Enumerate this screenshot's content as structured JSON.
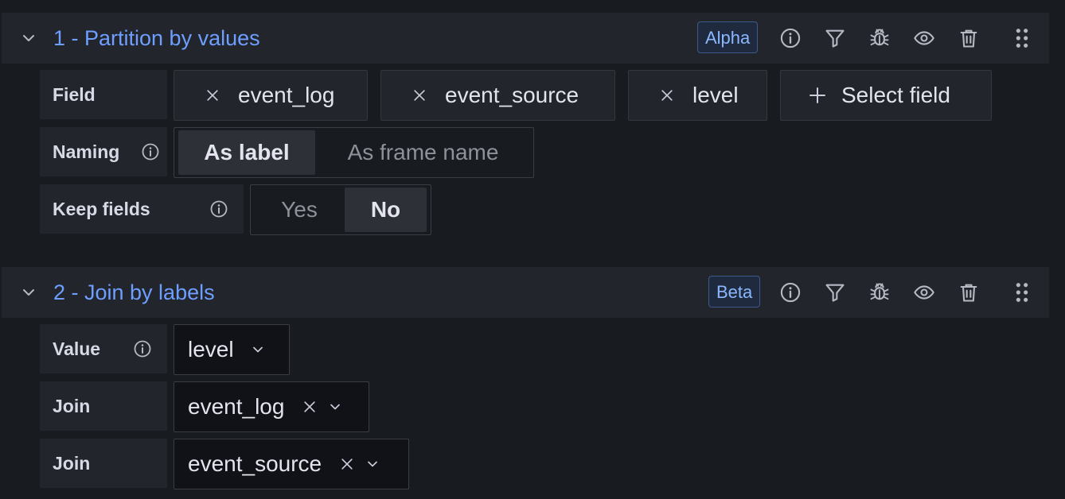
{
  "transform1": {
    "title": "1 - Partition by values",
    "badge": "Alpha",
    "field_label": "Field",
    "fields": [
      "event_log",
      "event_source",
      "level"
    ],
    "select_field_label": "Select field",
    "naming_label": "Naming",
    "naming_options": [
      "As label",
      "As frame name"
    ],
    "naming_selected": "As label",
    "keep_fields_label": "Keep fields",
    "keep_fields_options": [
      "Yes",
      "No"
    ],
    "keep_fields_selected": "No"
  },
  "transform2": {
    "title": "2 - Join by labels",
    "badge": "Beta",
    "value_label": "Value",
    "value_selected": "level",
    "join_label_1": "Join",
    "join_value_1": "event_log",
    "join_label_2": "Join",
    "join_value_2": "event_source"
  },
  "header_icons": [
    "info-icon",
    "filter-icon",
    "bug-icon",
    "eye-icon",
    "trash-icon",
    "drag-handle-icon"
  ],
  "colors": {
    "background": "#181b1f",
    "panel": "#22252b",
    "title_blue": "#6e9fff",
    "text": "#e3e4ee"
  }
}
